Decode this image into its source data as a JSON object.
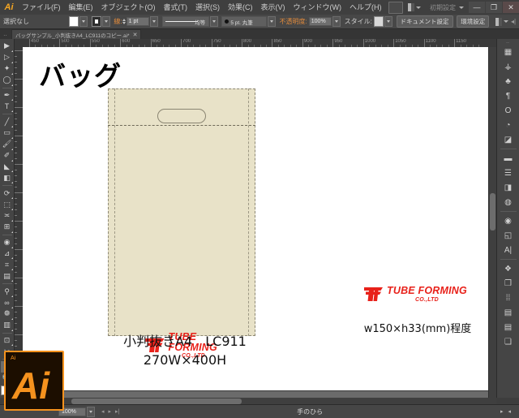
{
  "app": {
    "name": "Ai",
    "workspace_label": "初期設定"
  },
  "menubar": {
    "items": [
      {
        "label": "ファイル(F)"
      },
      {
        "label": "編集(E)"
      },
      {
        "label": "オブジェクト(O)"
      },
      {
        "label": "書式(T)"
      },
      {
        "label": "選択(S)"
      },
      {
        "label": "効果(C)"
      },
      {
        "label": "表示(V)"
      },
      {
        "label": "ウィンドウ(W)"
      },
      {
        "label": "ヘルプ(H)"
      }
    ],
    "window_buttons": {
      "minimize": "—",
      "maximize": "❐",
      "close": "✕"
    }
  },
  "controlbar": {
    "selection_status": "選択なし",
    "stroke_label": "線:",
    "stroke_weight": "1 pt",
    "stroke_profile": "均等",
    "brush_label": "5 pt. 丸筆",
    "opacity_label": "不透明度:",
    "opacity_value": "100%",
    "style_label": "スタイル:",
    "document_setup_button": "ドキュメント設定",
    "preferences_button": "環境設定"
  },
  "tabbar": {
    "document_tab": "バッグサンプル_小判抜きA4_LC911のコピー.ai*",
    "close_label": "✕"
  },
  "ruler": {
    "unit_marks": [
      "450",
      "500",
      "550",
      "600",
      "650",
      "700",
      "750",
      "800",
      "850",
      "900",
      "950",
      "1000",
      "1050",
      "1100",
      "1150"
    ]
  },
  "tools": {
    "items": [
      {
        "name": "selection-tool",
        "glyph": "▶"
      },
      {
        "name": "direct-selection-tool",
        "glyph": "▷"
      },
      {
        "name": "magic-wand-tool",
        "glyph": "✦"
      },
      {
        "name": "lasso-tool",
        "glyph": "◯"
      },
      {
        "name": "pen-tool",
        "glyph": "✒"
      },
      {
        "name": "type-tool",
        "glyph": "T"
      },
      {
        "name": "line-segment-tool",
        "glyph": "╱"
      },
      {
        "name": "rectangle-tool",
        "glyph": "▭"
      },
      {
        "name": "paintbrush-tool",
        "glyph": "🖌"
      },
      {
        "name": "pencil-tool",
        "glyph": "✐"
      },
      {
        "name": "blob-brush-tool",
        "glyph": "◣"
      },
      {
        "name": "eraser-tool",
        "glyph": "◧"
      },
      {
        "name": "rotate-tool",
        "glyph": "⟳"
      },
      {
        "name": "scale-tool",
        "glyph": "⬚"
      },
      {
        "name": "width-tool",
        "glyph": "≍"
      },
      {
        "name": "free-transform-tool",
        "glyph": "⊞"
      },
      {
        "name": "shape-builder-tool",
        "glyph": "◉"
      },
      {
        "name": "perspective-grid-tool",
        "glyph": "⊿"
      },
      {
        "name": "mesh-tool",
        "glyph": "⌗"
      },
      {
        "name": "gradient-tool",
        "glyph": "▤"
      },
      {
        "name": "eyedropper-tool",
        "glyph": "⚲"
      },
      {
        "name": "blend-tool",
        "glyph": "∞"
      },
      {
        "name": "symbol-sprayer-tool",
        "glyph": "❁"
      },
      {
        "name": "column-graph-tool",
        "glyph": "▥"
      },
      {
        "name": "artboard-tool",
        "glyph": "⊡"
      },
      {
        "name": "slice-tool",
        "glyph": "✂"
      },
      {
        "name": "hand-tool",
        "glyph": "✋"
      },
      {
        "name": "zoom-tool",
        "glyph": "🔍"
      }
    ],
    "active_tool": "hand-tool"
  },
  "right_panel": {
    "items": [
      {
        "name": "color-panel-icon",
        "glyph": "▦"
      },
      {
        "name": "color-guide-icon",
        "glyph": "⚶"
      },
      {
        "name": "kuler-icon",
        "glyph": "♣"
      },
      {
        "name": "paragraph-panel-icon",
        "glyph": "¶"
      },
      {
        "name": "stroke-panel-icon",
        "glyph": "Ο"
      },
      {
        "name": "swatches-panel-icon",
        "glyph": "◔"
      },
      {
        "name": "gradient-panel-icon",
        "glyph": "◪"
      },
      {
        "name": "align-panel-icon",
        "glyph": "▬"
      },
      {
        "name": "pathfinder-panel-icon",
        "glyph": "☰"
      },
      {
        "name": "transform-panel-icon",
        "glyph": "◨"
      },
      {
        "name": "transparency-panel-icon",
        "glyph": "◍"
      },
      {
        "name": "appearance-panel-icon",
        "glyph": "◉"
      },
      {
        "name": "graphic-styles-panel-icon",
        "glyph": "◱"
      },
      {
        "name": "character-panel-icon",
        "glyph": "A|"
      },
      {
        "name": "layers-panel-icon",
        "glyph": "❖"
      },
      {
        "name": "artboards-panel-icon",
        "glyph": "❐"
      },
      {
        "name": "symbols-panel-icon",
        "glyph": "⁞⁞"
      },
      {
        "name": "brushes-panel-icon",
        "glyph": "▤"
      },
      {
        "name": "links-panel-icon",
        "glyph": "▤"
      },
      {
        "name": "navigator-panel-icon",
        "glyph": "❏"
      }
    ]
  },
  "canvas": {
    "title": "バッグ",
    "logo": {
      "monogram": "TF",
      "wordmark": "TUBE FORMING",
      "subtext": "CO.,LTD",
      "color": "#e8211a"
    },
    "caption_main_line1": "小判抜きA4　LC911",
    "caption_main_line2": "270W×400H",
    "caption_right": "w150×h33(mm)程度",
    "bag_fill_color": "#e8e2c8"
  },
  "statusbar": {
    "zoom_level": "100%",
    "current_tool": "手のひら"
  },
  "dock": {
    "app_icon_letters": "Ai",
    "app_icon_small": "Ai"
  }
}
